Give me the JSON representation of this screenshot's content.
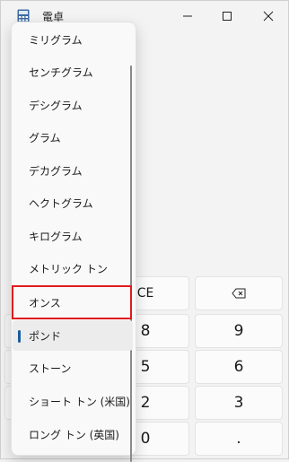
{
  "window": {
    "title": "電卓"
  },
  "keypad": {
    "ce": "CE",
    "backspace_icon": "backspace-icon",
    "row2": [
      "8",
      "9"
    ],
    "row3": [
      "5",
      "6"
    ],
    "row4": [
      "2",
      "3"
    ],
    "row5": [
      "0",
      "."
    ]
  },
  "dropdown": {
    "items": [
      "ミリグラム",
      "センチグラム",
      "デシグラム",
      "グラム",
      "デカグラム",
      "ヘクトグラム",
      "キログラム",
      "メトリック トン",
      "オンス",
      "ポンド",
      "ストーン",
      "ショート トン (米国)",
      "ロング トン (英国)"
    ],
    "selected_index": 9,
    "highlighted_index": 8
  },
  "colors": {
    "accent": "#1a5e9e",
    "highlight": "#e01b1b"
  }
}
